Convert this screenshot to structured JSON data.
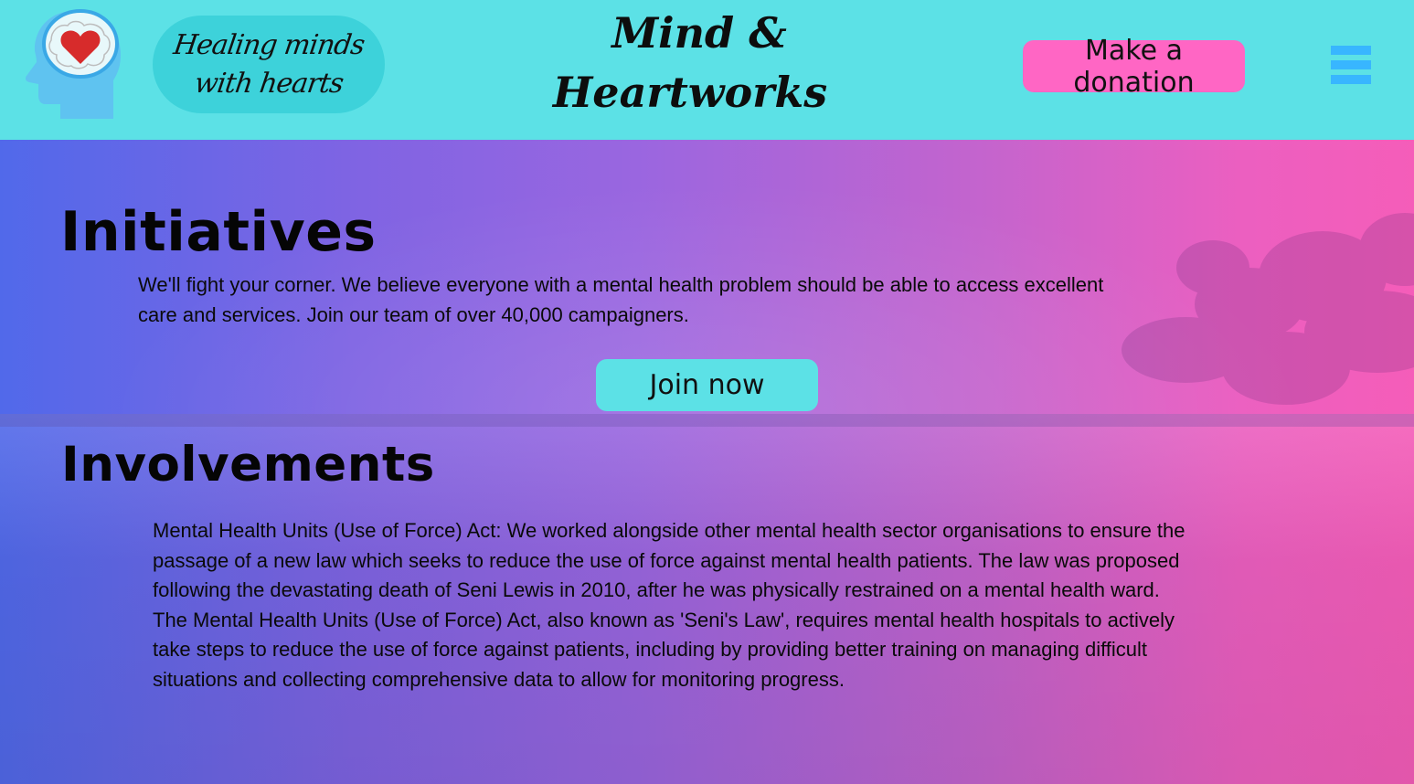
{
  "header": {
    "tagline_line1": "Healing minds",
    "tagline_line2": "with hearts",
    "brand_line1": "Mind &",
    "brand_line2": "Heartworks",
    "donate_label": "Make a donation",
    "menu_icon": "hamburger-menu-icon",
    "logo_icon": "head-with-heart-icon"
  },
  "initiatives": {
    "title": "Initiatives",
    "text": "We'll fight your corner. We believe everyone with a mental health problem should be able to access excellent care and services. Join our team of over 40,000 campaigners.",
    "button_label": "Join now"
  },
  "involvements": {
    "title": "Involvements",
    "text": "Mental Health Units (Use of Force) Act: We worked alongside other mental health sector organisations to ensure the passage of a new law which seeks to reduce the use of force against mental health patients. The law was proposed following the devastating death of Seni Lewis in 2010, after he was physically restrained on a mental health ward. The Mental Health Units (Use of Force) Act, also known as 'Seni's Law', requires mental health hospitals to actively take steps to reduce the use of force against patients, including by providing better training on managing difficult situations and collecting comprehensive data to allow for monitoring progress."
  },
  "colors": {
    "header_bg": "#5ce1e6",
    "pill_bg": "#3dd2da",
    "donate_bg": "#ff66c4",
    "menu_color": "#38b6ff",
    "gradient_start": "#5169ea",
    "gradient_end": "#f55db9"
  }
}
